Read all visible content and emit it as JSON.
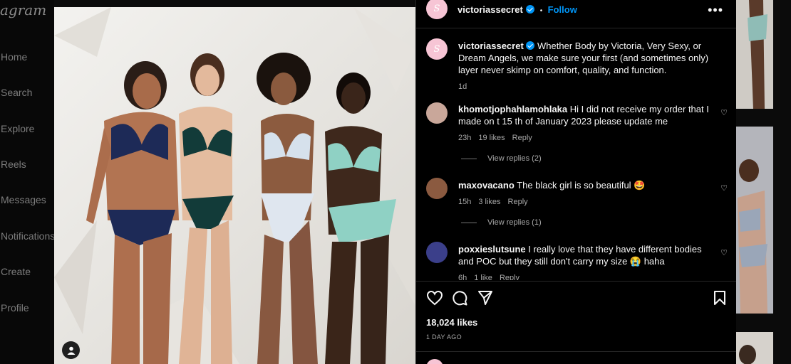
{
  "app": {
    "brand": "agram"
  },
  "nav": {
    "items": [
      {
        "label": "Home"
      },
      {
        "label": "Search"
      },
      {
        "label": "Explore"
      },
      {
        "label": "Reels"
      },
      {
        "label": "Messages"
      },
      {
        "label": "Notifications"
      },
      {
        "label": "Create"
      },
      {
        "label": "Profile"
      }
    ]
  },
  "post": {
    "author": "victoriassecret",
    "avatar_initial": "S",
    "follow_label": "Follow",
    "separator": "•",
    "more_label": "•••",
    "caption": "Whether Body by Victoria, Very Sexy, or Dream Angels, we make sure your first (and sometimes only) layer never skimp on comfort, quality, and function.",
    "caption_time": "1d",
    "likes": "18,024 likes",
    "time_ago": "1 DAY AGO"
  },
  "comments": [
    {
      "user": "khomotjophahlamohlaka",
      "text": "Hi I did not receive my order that I made on t 15 th of January 2023 please update me",
      "time": "23h",
      "likes": "19 likes",
      "reply": "Reply",
      "view_replies": "View replies (2)"
    },
    {
      "user": "maxovacano",
      "text": "The black girl is so beautiful 🤩",
      "time": "15h",
      "likes": "3 likes",
      "reply": "Reply",
      "view_replies": "View replies (1)"
    },
    {
      "user": "poxxieslutsune",
      "text": "I really love that they have different bodies and POC but they still don't carry my size 😭 haha",
      "time": "6h",
      "likes": "1 like",
      "reply": "Reply"
    }
  ],
  "colors": {
    "accent": "#0095f6",
    "panel_bg": "#000000",
    "muted": "#a8a8a8"
  },
  "icons": [
    "heart-icon",
    "comment-icon",
    "share-icon",
    "bookmark-icon",
    "user-tag-icon",
    "verified-icon"
  ]
}
